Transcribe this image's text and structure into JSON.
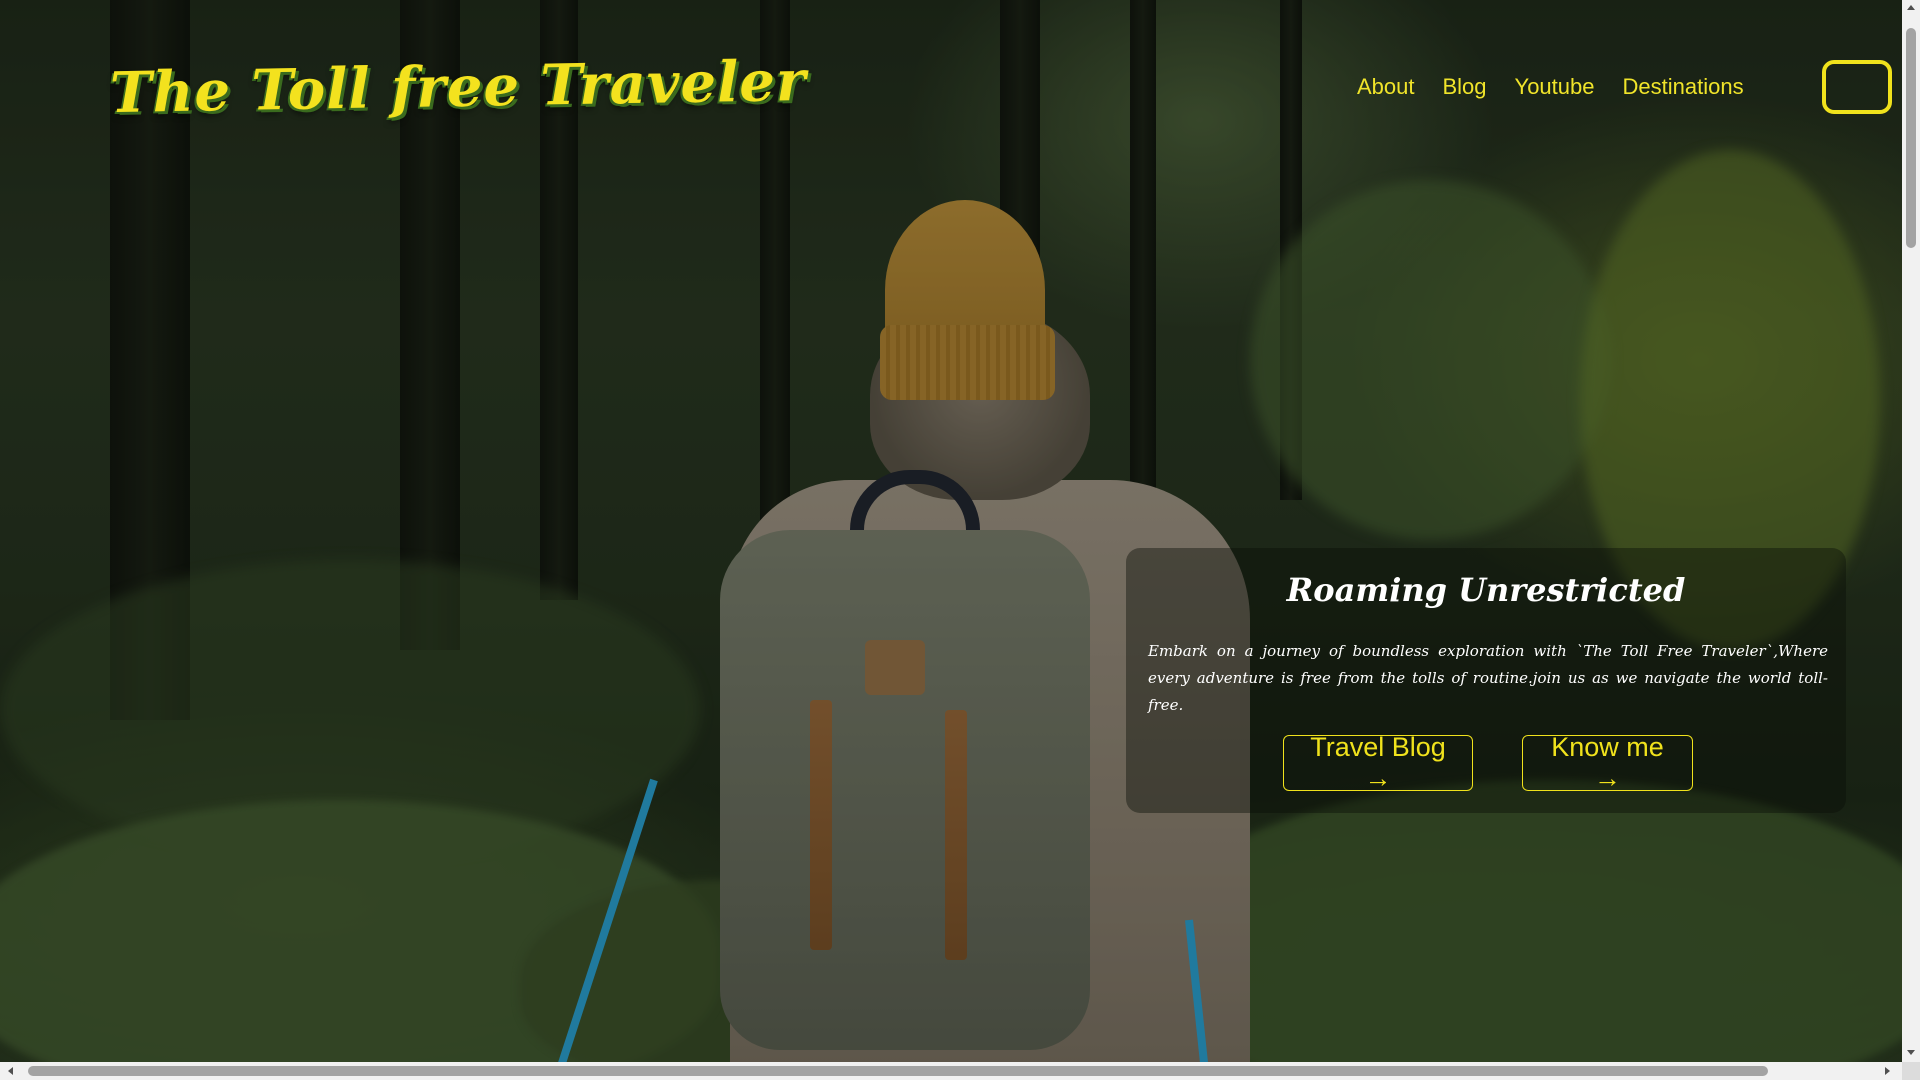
{
  "header": {
    "logo_text": "The Toll free Traveler",
    "nav": [
      {
        "label": "About"
      },
      {
        "label": "Blog"
      },
      {
        "label": "Youtube"
      },
      {
        "label": "Destinations"
      }
    ]
  },
  "hero": {
    "title": "Roaming Unrestricted",
    "text": "Embark on a journey of boundless exploration with `The Toll Free Traveler`,Where every adventure is free from the tolls of routine.join us as we navigate the world toll-free.",
    "buttons": {
      "travel_blog": "Travel Blog →",
      "know_me": "Know me →"
    }
  },
  "theme": {
    "accent": "#f0e21c",
    "logo_shadow": "#3a6b1e",
    "card_text": "#ffffff"
  },
  "icons": {
    "background": "forest-hiker-photo",
    "menu": "menu-box-icon"
  }
}
